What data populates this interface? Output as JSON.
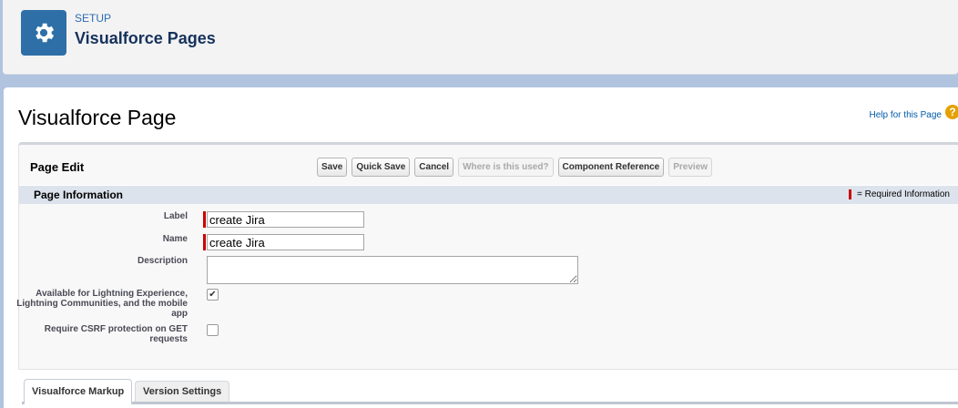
{
  "header": {
    "eyebrow": "SETUP",
    "title": "Visualforce Pages",
    "icon": "gear-icon"
  },
  "page": {
    "heading": "Visualforce Page",
    "help_link": "Help for this Page",
    "help_icon": "?"
  },
  "block": {
    "title": "Page Edit",
    "buttons": {
      "save": "Save",
      "quick_save": "Quick Save",
      "cancel": "Cancel",
      "where_used": "Where is this used?",
      "component_reference": "Component Reference",
      "preview": "Preview"
    }
  },
  "section": {
    "title": "Page Information",
    "required_legend": "= Required Information"
  },
  "fields": {
    "label": {
      "label": "Label",
      "value": "create Jira"
    },
    "name": {
      "label": "Name",
      "value": "create Jira"
    },
    "description": {
      "label": "Description",
      "value": ""
    },
    "lightning": {
      "label": "Available for Lightning Experience, Lightning Communities, and the mobile app",
      "checked": true
    },
    "csrf": {
      "label": "Require CSRF protection on GET requests",
      "checked": false
    }
  },
  "tabs": {
    "markup": "Visualforce Markup",
    "version": "Version Settings"
  },
  "colors": {
    "brand": "#2e6fa7",
    "required": "#cc0000",
    "background": "#b0c4df"
  }
}
